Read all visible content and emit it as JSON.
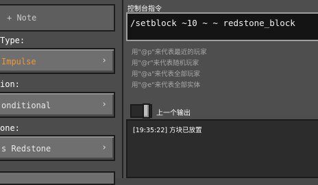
{
  "left": {
    "note": "+ Note",
    "type_label": "Type:",
    "type_value": "Impulse",
    "condition_label": "ion:",
    "condition_value": "onditional",
    "redstone_label": "one:",
    "redstone_value": "s Redstone",
    "chevron": "›"
  },
  "command": {
    "title": "控制台指令",
    "value": "/setblock ~10 ~ ~ redstone_block"
  },
  "hints": [
    "用\"@p\"来代表最近的玩家",
    "用\"@r\"来代表随机玩家",
    "用\"@a\"来代表全部玩家",
    "用\"@e\"来代表全部实体"
  ],
  "previous_output": {
    "label": "上一个输出",
    "enabled": true,
    "text": "[19:35:22] 方块已放置"
  },
  "colors": {
    "impulse_orange": "#f09a37"
  }
}
